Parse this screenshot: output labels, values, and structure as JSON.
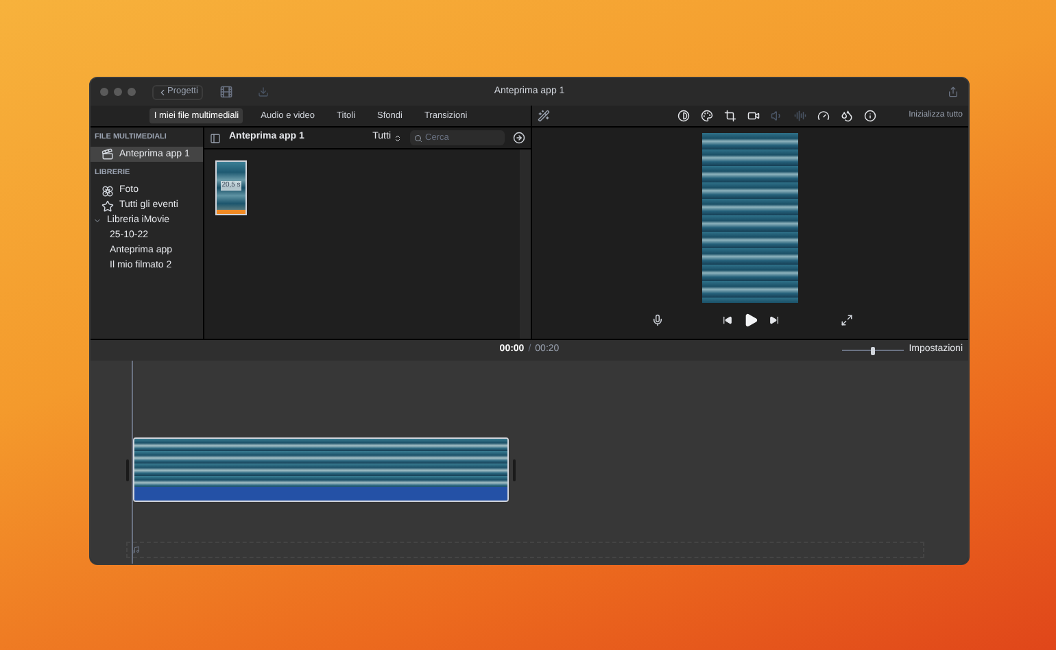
{
  "window": {
    "title": "Anteprima app 1",
    "back_button": "Progetti"
  },
  "media_tabs": [
    {
      "label": "I miei file multimediali",
      "selected": true
    },
    {
      "label": "Audio e video",
      "selected": false
    },
    {
      "label": "Titoli",
      "selected": false
    },
    {
      "label": "Sfondi",
      "selected": false
    },
    {
      "label": "Transizioni",
      "selected": false
    }
  ],
  "sidebar": {
    "sections": [
      {
        "heading": "FILE MULTIMEDIALI",
        "items": [
          {
            "kind": "project",
            "label": "Anteprima app 1",
            "selected": true
          }
        ]
      },
      {
        "heading": "LIBRERIE",
        "items": [
          {
            "kind": "photos",
            "label": "Foto",
            "selected": false
          },
          {
            "kind": "events",
            "label": "Tutti gli eventi",
            "selected": false
          },
          {
            "kind": "library",
            "label": "Libreria iMovie",
            "selected": false,
            "expanded": true,
            "children": [
              {
                "label": "25-10-22",
                "selected": false
              },
              {
                "label": "Anteprima app",
                "selected": false
              },
              {
                "label": "Il mio filmato 2",
                "selected": false
              }
            ]
          }
        ]
      }
    ]
  },
  "browser": {
    "title": "Anteprima app 1",
    "filter": "Tutti",
    "search_placeholder": "Cerca",
    "clips": [
      {
        "duration": "20,5 s"
      }
    ]
  },
  "viewer": {
    "reset_button": "Inizializza tutto"
  },
  "timeline": {
    "current_time": "00:00",
    "separator": "/",
    "total_time": "00:20",
    "settings_button": "Impostazioni",
    "zoom": {
      "level": 0.5
    }
  }
}
